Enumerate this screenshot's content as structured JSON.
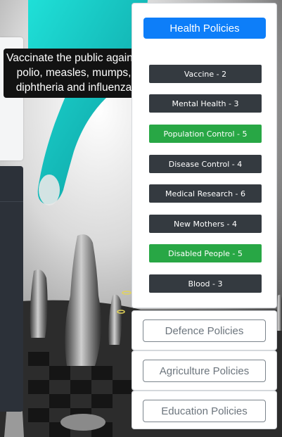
{
  "tooltip": {
    "lines": [
      "Vaccinate the public against",
      "polio, measles, mumps,",
      "diphtheria and influenza"
    ]
  },
  "health": {
    "header_label": "Health Policies",
    "policies": [
      {
        "label": "Vaccine - 2",
        "status": "dark"
      },
      {
        "label": "Mental Health - 3",
        "status": "dark"
      },
      {
        "label": "Population Control - 5",
        "status": "green"
      },
      {
        "label": "Disease Control - 4",
        "status": "dark"
      },
      {
        "label": "Medical Research - 6",
        "status": "dark"
      },
      {
        "label": "New Mothers - 4",
        "status": "dark"
      },
      {
        "label": "Disabled People - 5",
        "status": "green"
      },
      {
        "label": "Blood - 3",
        "status": "dark"
      }
    ]
  },
  "defence": {
    "header_label": "Defence Policies"
  },
  "agriculture": {
    "header_label": "Agriculture Policies"
  },
  "education": {
    "header_label": "Education Policies"
  },
  "colors": {
    "primary": "#0d7ef9",
    "selected": "#28a745",
    "unselected": "#343a40",
    "outline": "#7b848c"
  }
}
